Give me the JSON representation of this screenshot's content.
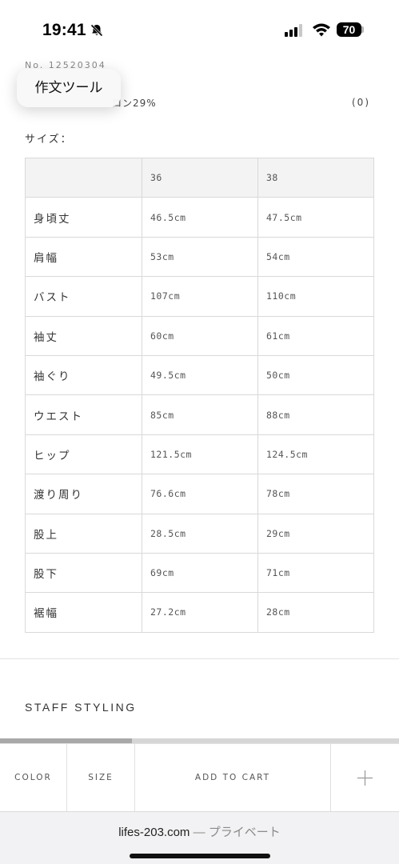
{
  "status_bar": {
    "time": "19:41",
    "battery_level": "70",
    "icons": [
      "bell-slash-icon",
      "cellular-signal-icon",
      "wifi-icon",
      "battery-icon"
    ]
  },
  "product": {
    "number": "No. 12520304",
    "material_fragment": "ロン29%",
    "count": "(0)"
  },
  "tooltip": {
    "label": "作文ツール"
  },
  "size_section": {
    "label": "サイズ：",
    "header": [
      "",
      "36",
      "38"
    ],
    "rows": [
      [
        "身頃丈",
        "46.5cm",
        "47.5cm"
      ],
      [
        "肩幅",
        "53cm",
        "54cm"
      ],
      [
        "バスト",
        "107cm",
        "110cm"
      ],
      [
        "袖丈",
        "60cm",
        "61cm"
      ],
      [
        "袖ぐり",
        "49.5cm",
        "50cm"
      ],
      [
        "ウエスト",
        "85cm",
        "88cm"
      ],
      [
        "ヒップ",
        "121.5cm",
        "124.5cm"
      ],
      [
        "渡り周り",
        "76.6cm",
        "78cm"
      ],
      [
        "股上",
        "28.5cm",
        "29cm"
      ],
      [
        "股下",
        "69cm",
        "71cm"
      ],
      [
        "裾幅",
        "27.2cm",
        "28cm"
      ]
    ]
  },
  "staff_styling": "STAFF STYLING",
  "scroll_progress": 0.33,
  "action_bar": {
    "color": "COLOR",
    "size": "SIZE",
    "add_to_cart": "ADD TO CART",
    "more_icon": "plus-icon"
  },
  "browser": {
    "domain": "lifes-203.com",
    "mode": " — プライベート"
  },
  "colors": {
    "table_border": "#d9d9d9",
    "header_bg": "#f3f3f3",
    "text": "#333333"
  }
}
